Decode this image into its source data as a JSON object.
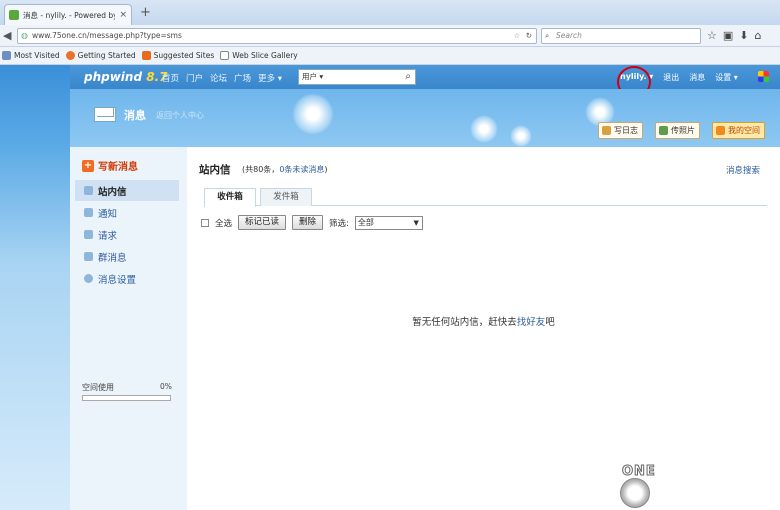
{
  "browser": {
    "tab_title": "消息 - nylily. - Powered by ...",
    "tab_close": "×",
    "new_tab": "+",
    "url_host": "www.75one.cn",
    "url_path": "/message.php?type=sms",
    "search_placeholder": "Search",
    "bookmarks": [
      "Most Visited",
      "Getting Started",
      "Suggested Sites",
      "Web Slice Gallery"
    ]
  },
  "site": {
    "logo": "phpwind",
    "logo_version": "8.7",
    "nav": [
      "首页",
      "门户",
      "论坛",
      "广场",
      "更多"
    ],
    "user_select": "用户",
    "username": "nylily.",
    "logout": "退出",
    "messages": "消息",
    "settings": "设置"
  },
  "banner": {
    "title": "消息",
    "subtitle": "返回个人中心",
    "buttons": [
      "写日志",
      "传照片",
      "我的空间"
    ]
  },
  "sidebar": {
    "compose": "写新消息",
    "items": [
      {
        "label": "站内信",
        "active": true
      },
      {
        "label": "通知"
      },
      {
        "label": "请求"
      },
      {
        "label": "群消息"
      },
      {
        "label": "消息设置"
      }
    ],
    "space_label": "空间使用",
    "space_percent": "0%",
    "space_usage": 0
  },
  "main": {
    "title": "站内信",
    "count_prefix": "(共80条，",
    "unread": "0条未读消息",
    "count_suffix": ")",
    "search_link": "消息搜索",
    "tabs": [
      "收件箱",
      "发件箱"
    ],
    "select_all": "全选",
    "mark_read": "标记已读",
    "delete": "删除",
    "filter_label": "筛选:",
    "filter_value": "全部",
    "empty_prefix": "暂无任何站内信，赶快去",
    "empty_link": "找好友",
    "empty_suffix": "吧"
  },
  "watermark": {
    "brand": "ONE",
    "cn": "壹号网站网",
    "url": "www.75one.cn"
  },
  "colors": {
    "accent_red": "#d00010",
    "link_blue": "#2a5b9a",
    "orange": "#f36b20"
  }
}
